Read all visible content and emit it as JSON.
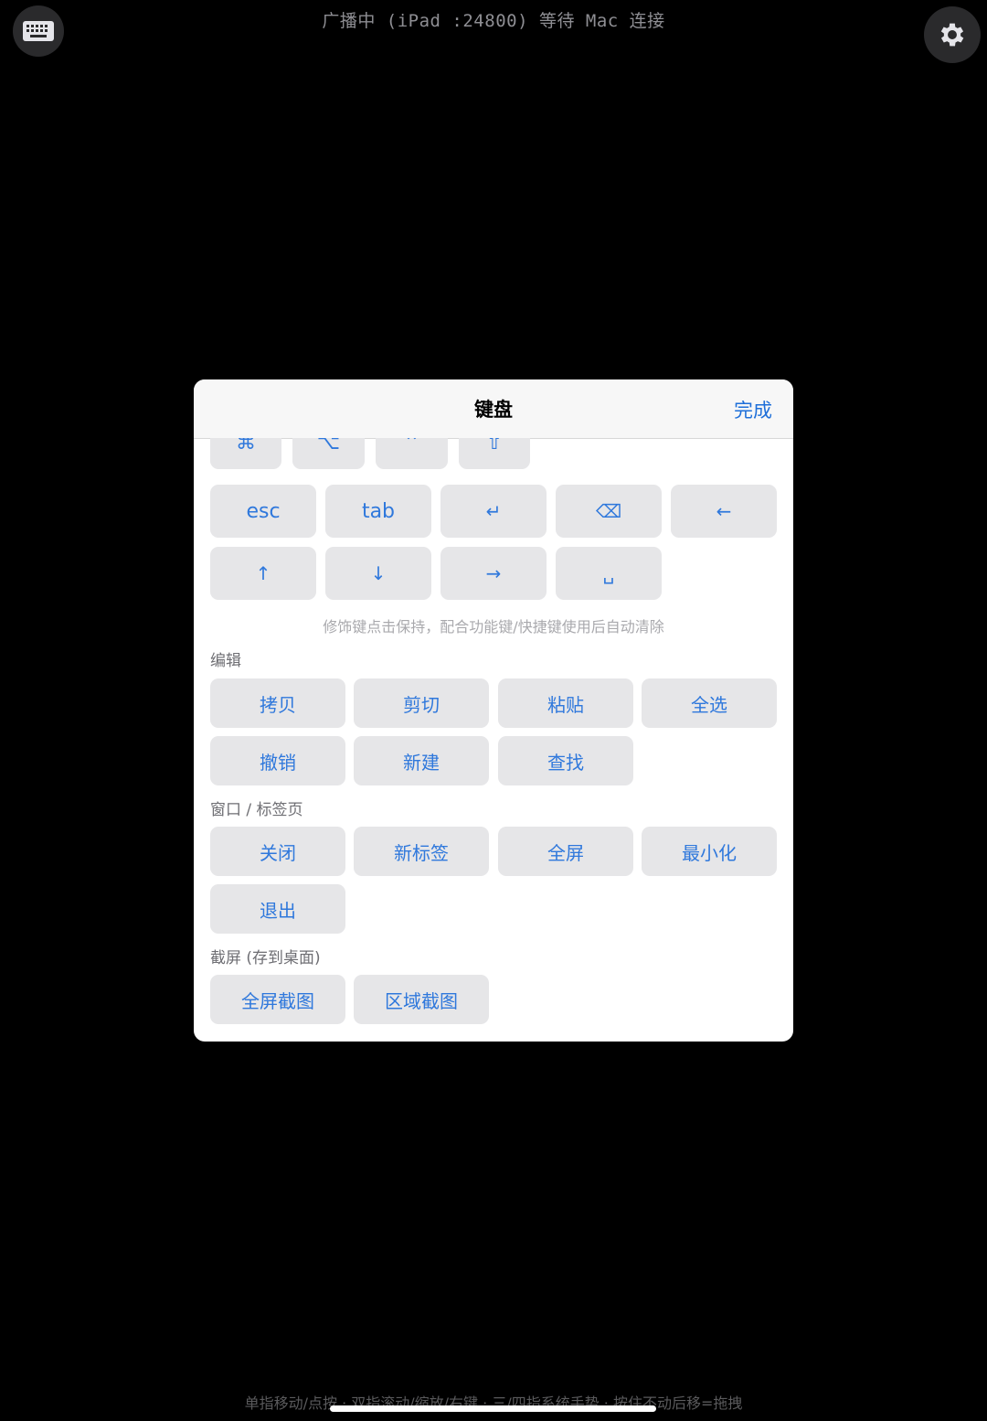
{
  "status": {
    "text": "广播中 (iPad :24800) 等待 Mac 连接"
  },
  "sheet": {
    "title": "键盘",
    "done": "完成"
  },
  "modifiers": [
    {
      "icon": "command-icon",
      "glyph": "⌘"
    },
    {
      "icon": "option-icon",
      "glyph": "⌥"
    },
    {
      "icon": "control-icon",
      "glyph": "⌃"
    },
    {
      "icon": "shift-icon",
      "glyph": "⇧"
    }
  ],
  "function_keys": {
    "esc": "esc",
    "tab": "tab",
    "return_glyph": "↵",
    "backspace_glyph": "⌫",
    "left_glyph": "←",
    "up_glyph": "↑",
    "down_glyph": "↓",
    "right_glyph": "→",
    "space_glyph": "␣"
  },
  "hint": "修饰键点击保持，配合功能键/快捷键使用后自动清除",
  "edit": {
    "title": "编辑",
    "buttons": [
      "拷贝",
      "剪切",
      "粘贴",
      "全选",
      "撤销",
      "新建",
      "查找"
    ]
  },
  "window": {
    "title": "窗口 / 标签页",
    "buttons": [
      "关闭",
      "新标签",
      "全屏",
      "最小化",
      "退出"
    ]
  },
  "screenshot": {
    "title": "截屏 (存到桌面)",
    "buttons": [
      "全屏截图",
      "区域截图"
    ]
  },
  "gesture_hint": "单指移动/点按 · 双指滚动/缩放/右键 · 三/四指系统手势 · 按住不动后移=拖拽",
  "colors": {
    "accent": "#2f78dc",
    "key_bg": "#e6e6e8",
    "background": "#000000"
  }
}
